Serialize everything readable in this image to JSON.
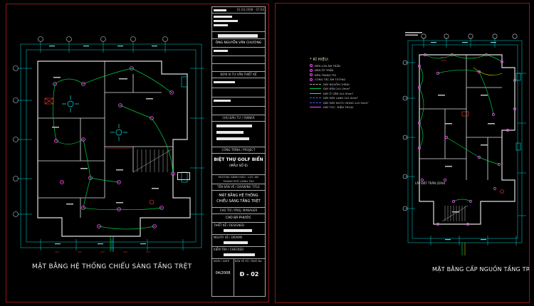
{
  "app": {
    "background": "#000000",
    "sheet_frame_color": "#8f1616"
  },
  "left_sheet": {
    "caption": "MẶT BẰNG HỆ THỐNG CHIẾU SÁNG TẦNG TRỆT"
  },
  "right_sheet": {
    "caption": "MẶT BẰNG CẤP NGUỒN TẦNG TRỆT",
    "ceiling_note": "LẮP ĐẶT TRẦN (DXH)"
  },
  "legend": {
    "title": "* KÍ HIỆU:",
    "items": [
      {
        "type": "circle",
        "dash": false,
        "color": "#ff4bff",
        "label": "ĐÈN LON ÂM TRẦN"
      },
      {
        "type": "circle",
        "dash": false,
        "color": "#ff4bff",
        "label": "ĐÈN ỐP TRẦN"
      },
      {
        "type": "circle",
        "dash": false,
        "color": "#ff4bff",
        "label": "ĐÈN TRANG TRÍ"
      },
      {
        "type": "circle",
        "dash": false,
        "color": "#ff4bff",
        "label": "CÔNG TẮC ÂM TƯỜNG"
      },
      {
        "type": "line",
        "dash": true,
        "color": "#b5b5b5",
        "label": "DÂY NGUỒN CHÍNH"
      },
      {
        "type": "line",
        "dash": false,
        "color": "#00cc44",
        "label": "DÂY ĐÈN 2x1.5mm²"
      },
      {
        "type": "line",
        "dash": false,
        "color": "#00e5e5",
        "label": "DÂY Ổ CẮM 2x2.5mm²"
      },
      {
        "type": "line",
        "dash": true,
        "color": "#4169ff",
        "label": "DÂY MÁY LẠNH 2x2.5mm²"
      },
      {
        "type": "line",
        "dash": true,
        "color": "#4169ff",
        "label": "DÂY MÁY NƯỚC NÓNG 2x2.5mm²"
      },
      {
        "type": "line",
        "dash": false,
        "color": "#ff4bff",
        "label": "DÂY TIVI - ĐIỆN THOẠI"
      }
    ]
  },
  "titleblock": {
    "print_stamp": "01.04.2008 - 07:04",
    "architect_name": "ÔNG NGUYỄN VĂN CHƯƠNG",
    "consultant_label": "ĐƠN VỊ TƯ VẤN THIẾT KẾ",
    "owner_label": "CHỦ ĐẦU TƯ / OWNER",
    "project_label": "CÔNG TRÌNH / PROJECT",
    "project_name": "BIỆT THỰ GOLF BIỂN",
    "project_sub": "(MẪU SỐ 6)",
    "address_line1": "ĐƯỜNG GÀNH HÀO - LỘC AN",
    "address_line2": "THÀNH PHỐ VŨNG TÀU",
    "drawing_label": "TÊN BẢN VẼ / DRAWING TITLE",
    "drawing_name_line1": "MẶT BẰNG HỆ THỐNG",
    "drawing_name_line2": "CHIẾU SÁNG TẦNG TRỆT",
    "lead_label": "CHỦ TRÌ / PROJ. MANAGER",
    "lead_name": "CAO BÁ PHƯỚC",
    "designed_label": "THIẾT KẾ / DESIGNED",
    "drawn_label": "NGƯỜI VẼ / DRAWN",
    "checked_label": "KIỂM TRA / CHECKED",
    "date_label": "NGÀY / DATE",
    "date_value": "04/2008",
    "sheet_label": "BẢN VẼ SỐ / DWG No.",
    "sheet_value": "Đ - 02"
  }
}
